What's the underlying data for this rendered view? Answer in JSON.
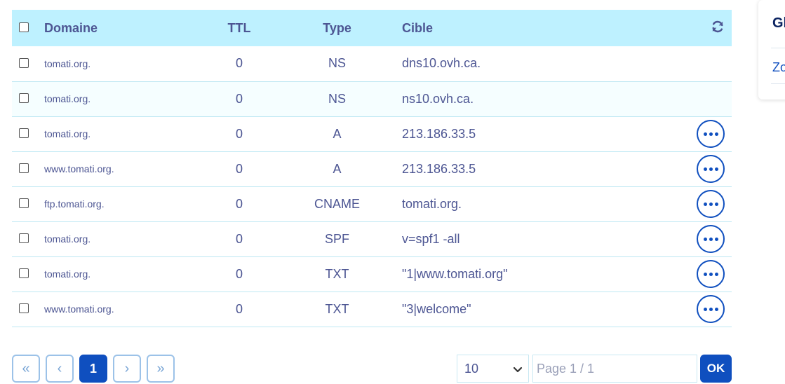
{
  "table": {
    "headers": {
      "domain": "Domaine",
      "ttl": "TTL",
      "type": "Type",
      "target": "Cible"
    },
    "rows": [
      {
        "domain": "tomati.org.",
        "ttl": "0",
        "type": "NS",
        "target": "dns10.ovh.ca.",
        "has_actions": false
      },
      {
        "domain": "tomati.org.",
        "ttl": "0",
        "type": "NS",
        "target": "ns10.ovh.ca.",
        "has_actions": false
      },
      {
        "domain": "tomati.org.",
        "ttl": "0",
        "type": "A",
        "target": "213.186.33.5",
        "has_actions": true
      },
      {
        "domain": "www.tomati.org.",
        "ttl": "0",
        "type": "A",
        "target": "213.186.33.5",
        "has_actions": true
      },
      {
        "domain": "ftp.tomati.org.",
        "ttl": "0",
        "type": "CNAME",
        "target": "tomati.org.",
        "has_actions": true
      },
      {
        "domain": "tomati.org.",
        "ttl": "0",
        "type": "SPF",
        "target": "v=spf1 -all",
        "has_actions": true
      },
      {
        "domain": "tomati.org.",
        "ttl": "0",
        "type": "TXT",
        "target": "\"1|www.tomati.org\"",
        "has_actions": true
      },
      {
        "domain": "www.tomati.org.",
        "ttl": "0",
        "type": "TXT",
        "target": "\"3|welcome\"",
        "has_actions": true
      }
    ]
  },
  "pagination": {
    "first": "«",
    "prev": "‹",
    "current": "1",
    "next": "›",
    "last": "»",
    "page_size": "10",
    "page_placeholder": "Page 1 / 1",
    "ok_label": "OK"
  },
  "side_panel": {
    "title": "Gl",
    "link": "Zo"
  },
  "colors": {
    "header_bg": "#bef1ff",
    "accent": "#0f4fbf",
    "text": "#4d5693"
  },
  "icons": {
    "refresh": "refresh-icon",
    "row_actions": "more-options-icon",
    "select_chevron": "chevron-down-icon"
  }
}
